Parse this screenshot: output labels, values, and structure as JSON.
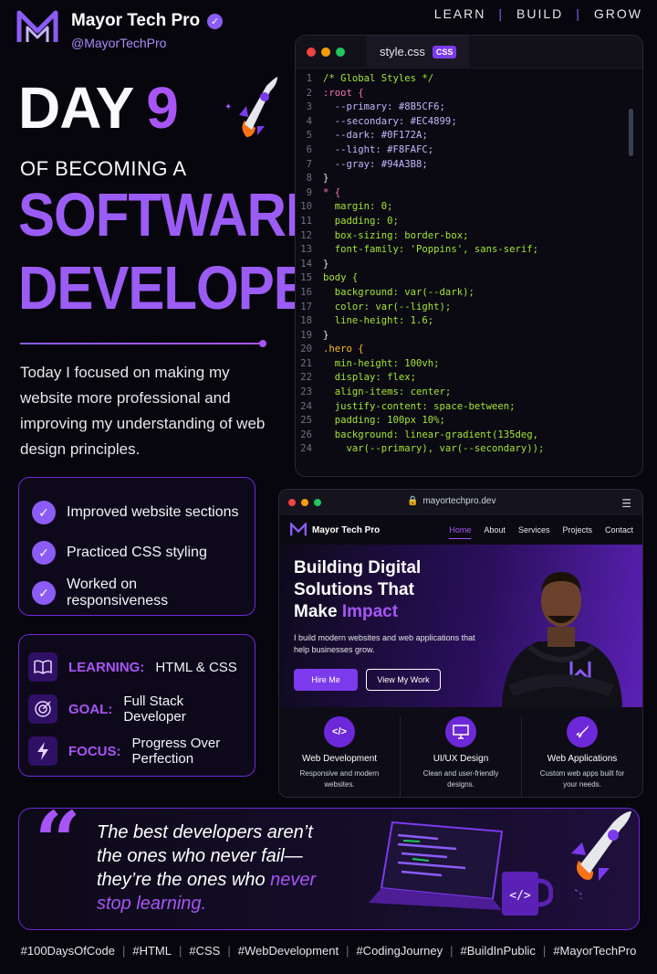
{
  "header": {
    "brand": "Mayor Tech Pro",
    "handle": "@MayorTechPro",
    "tagline": [
      "LEARN",
      "BUILD",
      "GROW"
    ]
  },
  "title": {
    "day": "DAY",
    "day_num": "9",
    "sub": "OF BECOMING A",
    "line1": "SOFTWARE",
    "line2": "DEVELOPER"
  },
  "intro": "Today I focused on making my website more professional and improving my understanding of web design principles.",
  "checklist": [
    "Improved website sections",
    "Practiced CSS styling",
    "Worked on responsiveness"
  ],
  "info": [
    {
      "key": "LEARNING:",
      "value": "HTML & CSS",
      "icon": "book-icon"
    },
    {
      "key": "GOAL:",
      "value": "Full Stack Developer",
      "icon": "target-icon"
    },
    {
      "key": "FOCUS:",
      "value": "Progress Over Perfection",
      "icon": "lightning-icon"
    }
  ],
  "editor": {
    "tab": "style.css",
    "badge": "CSS",
    "lines": [
      {
        "n": "1",
        "t": "/* Global Styles */",
        "c": "#A3E635"
      },
      {
        "n": "2",
        "t": ":root {",
        "c": "#F472B6"
      },
      {
        "n": "3",
        "t": "  --primary: #8B5CF6;",
        "c": "#C4B5FD"
      },
      {
        "n": "4",
        "t": "  --secondary: #EC4899;",
        "c": "#C4B5FD"
      },
      {
        "n": "5",
        "t": "  --dark: #0F172A;",
        "c": "#C4B5FD"
      },
      {
        "n": "6",
        "t": "  --light: #F8FAFC;",
        "c": "#C4B5FD"
      },
      {
        "n": "7",
        "t": "  --gray: #94A3B8;",
        "c": "#C4B5FD"
      },
      {
        "n": "8",
        "t": "}",
        "c": "#E5E7EB"
      },
      {
        "n": "9",
        "t": "* {",
        "c": "#F472B6"
      },
      {
        "n": "10",
        "t": "  margin: 0;",
        "c": "#A3E635"
      },
      {
        "n": "11",
        "t": "  padding: 0;",
        "c": "#A3E635"
      },
      {
        "n": "12",
        "t": "  box-sizing: border-box;",
        "c": "#A3E635"
      },
      {
        "n": "13",
        "t": "  font-family: 'Poppins', sans-serif;",
        "c": "#A3E635"
      },
      {
        "n": "14",
        "t": "}",
        "c": "#E5E7EB"
      },
      {
        "n": "15",
        "t": "body {",
        "c": "#A3E635"
      },
      {
        "n": "16",
        "t": "  background: var(--dark);",
        "c": "#A3E635"
      },
      {
        "n": "17",
        "t": "  color: var(--light);",
        "c": "#A3E635"
      },
      {
        "n": "18",
        "t": "  line-height: 1.6;",
        "c": "#A3E635"
      },
      {
        "n": "19",
        "t": "}",
        "c": "#E5E7EB"
      },
      {
        "n": "20",
        "t": ".hero {",
        "c": "#FBBF24"
      },
      {
        "n": "21",
        "t": "  min-height: 100vh;",
        "c": "#A3E635"
      },
      {
        "n": "22",
        "t": "  display: flex;",
        "c": "#A3E635"
      },
      {
        "n": "23",
        "t": "  align-items: center;",
        "c": "#A3E635"
      },
      {
        "n": "24",
        "t": "  justify-content: space-between;",
        "c": "#A3E635"
      },
      {
        "n": "25",
        "t": "  padding: 100px 10%;",
        "c": "#A3E635"
      },
      {
        "n": "26",
        "t": "  background: linear-gradient(135deg,",
        "c": "#A3E635"
      },
      {
        "n": "24",
        "t": "    var(--primary), var(--secondary));",
        "c": "#A3E635"
      }
    ]
  },
  "browser": {
    "url": "mayortechpro.dev",
    "site_brand": "Mayor Tech Pro",
    "nav": [
      "Home",
      "About",
      "Services",
      "Projects",
      "Contact"
    ],
    "hero_l1": "Building Digital",
    "hero_l2": "Solutions That",
    "hero_l3a": "Make ",
    "hero_l3b": "Impact",
    "hero_p": "I build modern websites and web applications that help businesses grow.",
    "btn_primary": "Hire Me",
    "btn_secondary": "View My Work",
    "services": [
      {
        "icon": "code-icon",
        "glyph": "</>",
        "title": "Web Development",
        "desc": "Responsive and modern websites."
      },
      {
        "icon": "monitor-icon",
        "glyph": "▭",
        "title": "UI/UX Design",
        "desc": "Clean and user-friendly designs."
      },
      {
        "icon": "rocket-icon",
        "glyph": "🚀",
        "title": "Web Applications",
        "desc": "Custom web apps built for your needs."
      }
    ]
  },
  "quote": {
    "l1": "The best developers aren’t",
    "l2": "the ones who never fail—",
    "l3a": "they’re the ones who ",
    "l3b": "never",
    "l4": "stop learning."
  },
  "hashtags": [
    "#100DaysOfCode",
    "#HTML",
    "#CSS",
    "#WebDevelopment",
    "#CodingJourney",
    "#BuildInPublic",
    "#MayorTechPro"
  ],
  "colors": {
    "accent": "#8B5CF6",
    "accent_light": "#A855F7",
    "background": "#07060c"
  }
}
